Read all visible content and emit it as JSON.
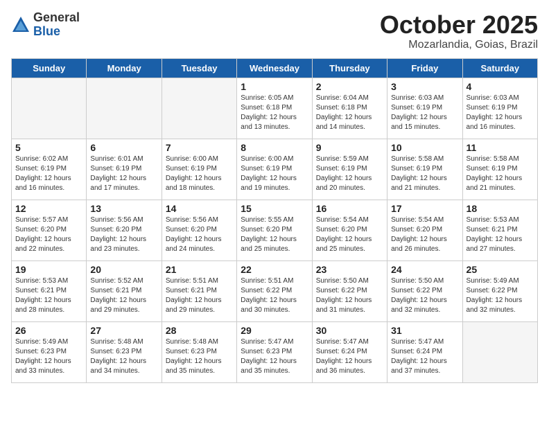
{
  "header": {
    "logo_general": "General",
    "logo_blue": "Blue",
    "month_title": "October 2025",
    "subtitle": "Mozarlandia, Goias, Brazil"
  },
  "days_of_week": [
    "Sunday",
    "Monday",
    "Tuesday",
    "Wednesday",
    "Thursday",
    "Friday",
    "Saturday"
  ],
  "weeks": [
    [
      {
        "day": "",
        "empty": true
      },
      {
        "day": "",
        "empty": true
      },
      {
        "day": "",
        "empty": true
      },
      {
        "day": "1",
        "lines": [
          "Sunrise: 6:05 AM",
          "Sunset: 6:18 PM",
          "Daylight: 12 hours",
          "and 13 minutes."
        ]
      },
      {
        "day": "2",
        "lines": [
          "Sunrise: 6:04 AM",
          "Sunset: 6:18 PM",
          "Daylight: 12 hours",
          "and 14 minutes."
        ]
      },
      {
        "day": "3",
        "lines": [
          "Sunrise: 6:03 AM",
          "Sunset: 6:19 PM",
          "Daylight: 12 hours",
          "and 15 minutes."
        ]
      },
      {
        "day": "4",
        "lines": [
          "Sunrise: 6:03 AM",
          "Sunset: 6:19 PM",
          "Daylight: 12 hours",
          "and 16 minutes."
        ]
      }
    ],
    [
      {
        "day": "5",
        "lines": [
          "Sunrise: 6:02 AM",
          "Sunset: 6:19 PM",
          "Daylight: 12 hours",
          "and 16 minutes."
        ]
      },
      {
        "day": "6",
        "lines": [
          "Sunrise: 6:01 AM",
          "Sunset: 6:19 PM",
          "Daylight: 12 hours",
          "and 17 minutes."
        ]
      },
      {
        "day": "7",
        "lines": [
          "Sunrise: 6:00 AM",
          "Sunset: 6:19 PM",
          "Daylight: 12 hours",
          "and 18 minutes."
        ]
      },
      {
        "day": "8",
        "lines": [
          "Sunrise: 6:00 AM",
          "Sunset: 6:19 PM",
          "Daylight: 12 hours",
          "and 19 minutes."
        ]
      },
      {
        "day": "9",
        "lines": [
          "Sunrise: 5:59 AM",
          "Sunset: 6:19 PM",
          "Daylight: 12 hours",
          "and 20 minutes."
        ]
      },
      {
        "day": "10",
        "lines": [
          "Sunrise: 5:58 AM",
          "Sunset: 6:19 PM",
          "Daylight: 12 hours",
          "and 21 minutes."
        ]
      },
      {
        "day": "11",
        "lines": [
          "Sunrise: 5:58 AM",
          "Sunset: 6:19 PM",
          "Daylight: 12 hours",
          "and 21 minutes."
        ]
      }
    ],
    [
      {
        "day": "12",
        "lines": [
          "Sunrise: 5:57 AM",
          "Sunset: 6:20 PM",
          "Daylight: 12 hours",
          "and 22 minutes."
        ]
      },
      {
        "day": "13",
        "lines": [
          "Sunrise: 5:56 AM",
          "Sunset: 6:20 PM",
          "Daylight: 12 hours",
          "and 23 minutes."
        ]
      },
      {
        "day": "14",
        "lines": [
          "Sunrise: 5:56 AM",
          "Sunset: 6:20 PM",
          "Daylight: 12 hours",
          "and 24 minutes."
        ]
      },
      {
        "day": "15",
        "lines": [
          "Sunrise: 5:55 AM",
          "Sunset: 6:20 PM",
          "Daylight: 12 hours",
          "and 25 minutes."
        ]
      },
      {
        "day": "16",
        "lines": [
          "Sunrise: 5:54 AM",
          "Sunset: 6:20 PM",
          "Daylight: 12 hours",
          "and 25 minutes."
        ]
      },
      {
        "day": "17",
        "lines": [
          "Sunrise: 5:54 AM",
          "Sunset: 6:20 PM",
          "Daylight: 12 hours",
          "and 26 minutes."
        ]
      },
      {
        "day": "18",
        "lines": [
          "Sunrise: 5:53 AM",
          "Sunset: 6:21 PM",
          "Daylight: 12 hours",
          "and 27 minutes."
        ]
      }
    ],
    [
      {
        "day": "19",
        "lines": [
          "Sunrise: 5:53 AM",
          "Sunset: 6:21 PM",
          "Daylight: 12 hours",
          "and 28 minutes."
        ]
      },
      {
        "day": "20",
        "lines": [
          "Sunrise: 5:52 AM",
          "Sunset: 6:21 PM",
          "Daylight: 12 hours",
          "and 29 minutes."
        ]
      },
      {
        "day": "21",
        "lines": [
          "Sunrise: 5:51 AM",
          "Sunset: 6:21 PM",
          "Daylight: 12 hours",
          "and 29 minutes."
        ]
      },
      {
        "day": "22",
        "lines": [
          "Sunrise: 5:51 AM",
          "Sunset: 6:22 PM",
          "Daylight: 12 hours",
          "and 30 minutes."
        ]
      },
      {
        "day": "23",
        "lines": [
          "Sunrise: 5:50 AM",
          "Sunset: 6:22 PM",
          "Daylight: 12 hours",
          "and 31 minutes."
        ]
      },
      {
        "day": "24",
        "lines": [
          "Sunrise: 5:50 AM",
          "Sunset: 6:22 PM",
          "Daylight: 12 hours",
          "and 32 minutes."
        ]
      },
      {
        "day": "25",
        "lines": [
          "Sunrise: 5:49 AM",
          "Sunset: 6:22 PM",
          "Daylight: 12 hours",
          "and 32 minutes."
        ]
      }
    ],
    [
      {
        "day": "26",
        "lines": [
          "Sunrise: 5:49 AM",
          "Sunset: 6:23 PM",
          "Daylight: 12 hours",
          "and 33 minutes."
        ]
      },
      {
        "day": "27",
        "lines": [
          "Sunrise: 5:48 AM",
          "Sunset: 6:23 PM",
          "Daylight: 12 hours",
          "and 34 minutes."
        ]
      },
      {
        "day": "28",
        "lines": [
          "Sunrise: 5:48 AM",
          "Sunset: 6:23 PM",
          "Daylight: 12 hours",
          "and 35 minutes."
        ]
      },
      {
        "day": "29",
        "lines": [
          "Sunrise: 5:47 AM",
          "Sunset: 6:23 PM",
          "Daylight: 12 hours",
          "and 35 minutes."
        ]
      },
      {
        "day": "30",
        "lines": [
          "Sunrise: 5:47 AM",
          "Sunset: 6:24 PM",
          "Daylight: 12 hours",
          "and 36 minutes."
        ]
      },
      {
        "day": "31",
        "lines": [
          "Sunrise: 5:47 AM",
          "Sunset: 6:24 PM",
          "Daylight: 12 hours",
          "and 37 minutes."
        ]
      },
      {
        "day": "",
        "empty": true
      }
    ]
  ]
}
